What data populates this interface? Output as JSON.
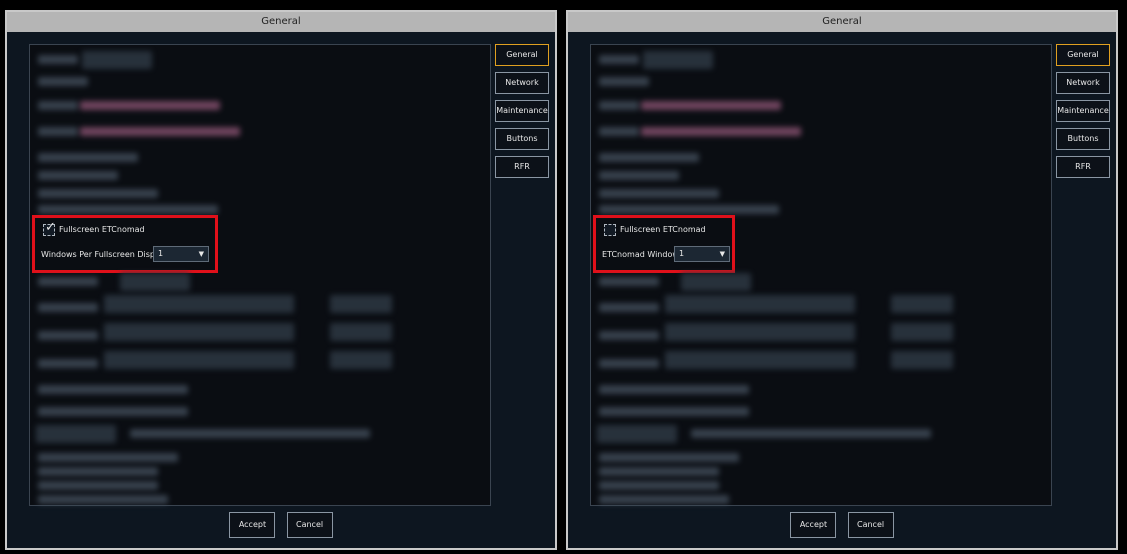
{
  "left": {
    "title": "General",
    "sidebar": [
      "General",
      "Network",
      "Maintenance",
      "Buttons",
      "RFR"
    ],
    "fullscreen_label": "Fullscreen ETCnomad",
    "fullscreen_checked": true,
    "windows_label": "Windows Per Fullscreen Display",
    "windows_value": "1",
    "accept_label": "Accept",
    "cancel_label": "Cancel"
  },
  "right": {
    "title": "General",
    "sidebar": [
      "General",
      "Network",
      "Maintenance",
      "Buttons",
      "RFR"
    ],
    "fullscreen_label": "Fullscreen ETCnomad",
    "fullscreen_checked": false,
    "windows_label": "ETCnomad Windows",
    "windows_value": "1",
    "accept_label": "Accept",
    "cancel_label": "Cancel"
  },
  "colors": {
    "highlight": "#e0101a",
    "active_border": "#e0a020",
    "panel_bg": "#0d1620"
  },
  "icons": {
    "checkmark": "✓",
    "caret": "▼"
  }
}
